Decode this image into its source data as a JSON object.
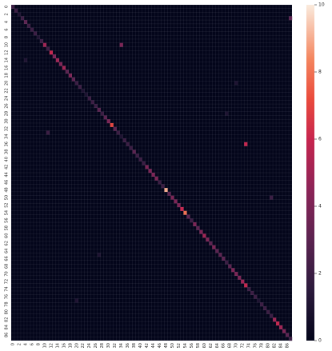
{
  "chart_data": {
    "type": "heatmap",
    "title": "",
    "xlabel": "",
    "ylabel": "",
    "n_classes": 88,
    "x_tick_labels": [
      "0",
      "2",
      "4",
      "6",
      "8",
      "10",
      "12",
      "14",
      "16",
      "18",
      "20",
      "22",
      "24",
      "26",
      "28",
      "30",
      "32",
      "34",
      "36",
      "38",
      "40",
      "42",
      "44",
      "46",
      "48",
      "50",
      "52",
      "54",
      "56",
      "58",
      "60",
      "62",
      "64",
      "66",
      "68",
      "70",
      "72",
      "74",
      "76",
      "78",
      "80",
      "82",
      "84",
      "86"
    ],
    "y_tick_labels": [
      "0",
      "2",
      "4",
      "6",
      "8",
      "10",
      "12",
      "14",
      "16",
      "18",
      "20",
      "22",
      "24",
      "26",
      "28",
      "30",
      "32",
      "34",
      "36",
      "38",
      "40",
      "42",
      "44",
      "46",
      "48",
      "50",
      "52",
      "54",
      "56",
      "58",
      "60",
      "62",
      "64",
      "66",
      "68",
      "70",
      "72",
      "74",
      "76",
      "78",
      "80",
      "82",
      "84",
      "86"
    ],
    "colorbar": {
      "vmin": 0,
      "vmax": 10,
      "tick_labels": [
        "0",
        "2",
        "4",
        "6",
        "8",
        "10"
      ],
      "colormap": "rocket"
    },
    "diagonal_values": [
      2,
      2,
      1,
      2,
      3,
      2,
      2,
      2,
      1,
      2,
      5,
      2,
      6,
      4,
      5,
      4,
      5,
      3,
      4,
      3,
      2,
      2,
      1,
      1,
      2,
      2,
      2,
      3,
      2,
      3,
      4,
      7,
      3,
      2,
      1,
      2,
      2,
      2,
      3,
      2,
      2,
      2,
      4,
      4,
      4,
      4,
      2,
      2,
      9,
      3,
      4,
      4,
      4,
      6,
      8,
      3,
      2,
      4,
      3,
      4,
      5,
      4,
      3,
      4,
      3,
      3,
      3,
      2,
      3,
      4,
      4,
      4,
      5,
      6,
      2,
      2,
      2,
      1,
      2,
      2,
      2,
      2,
      5,
      6,
      5,
      4,
      3,
      2
    ],
    "off_diagonal": [
      {
        "row": 10,
        "col": 34,
        "value": 4
      },
      {
        "row": 36,
        "col": 73,
        "value": 6
      },
      {
        "row": 3,
        "col": 87,
        "value": 3
      },
      {
        "row": 14,
        "col": 4,
        "value": 1
      },
      {
        "row": 20,
        "col": 70,
        "value": 1
      },
      {
        "row": 28,
        "col": 67,
        "value": 1
      },
      {
        "row": 33,
        "col": 11,
        "value": 2
      },
      {
        "row": 50,
        "col": 81,
        "value": 2
      },
      {
        "row": 65,
        "col": 27,
        "value": 1
      },
      {
        "row": 77,
        "col": 20,
        "value": 1
      }
    ]
  }
}
